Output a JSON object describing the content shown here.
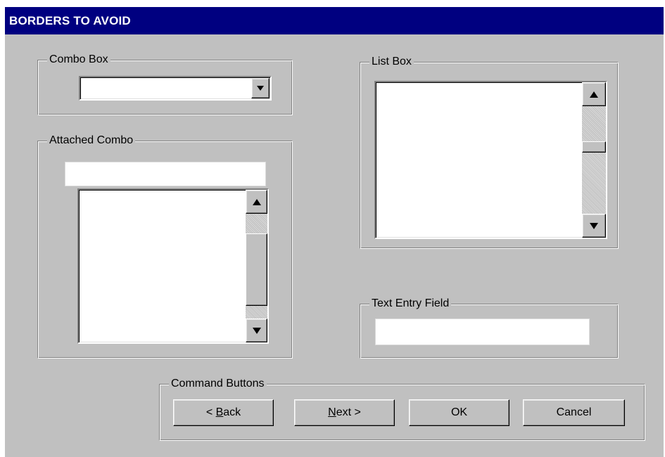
{
  "window": {
    "title": "BORDERS TO AVOID"
  },
  "combo_box": {
    "group_label": "Combo Box",
    "value": ""
  },
  "attached_combo": {
    "group_label": "Attached Combo",
    "input_value": "",
    "items": []
  },
  "list_box": {
    "group_label": "List Box",
    "items": []
  },
  "text_entry": {
    "group_label": "Text Entry Field",
    "value": ""
  },
  "command_buttons": {
    "group_label": "Command Buttons",
    "buttons": [
      {
        "label": "< Back",
        "mnemonic": "B"
      },
      {
        "label": "Next >",
        "mnemonic": "N"
      },
      {
        "label": "OK"
      },
      {
        "label": "Cancel"
      }
    ]
  },
  "icons": [
    "scroll-up-arrow-icon",
    "scroll-down-arrow-icon",
    "dropdown-arrow-icon"
  ],
  "colors": {
    "titlebar": "#000080",
    "window_face": "#c0c0c0",
    "field": "#ffffff"
  }
}
